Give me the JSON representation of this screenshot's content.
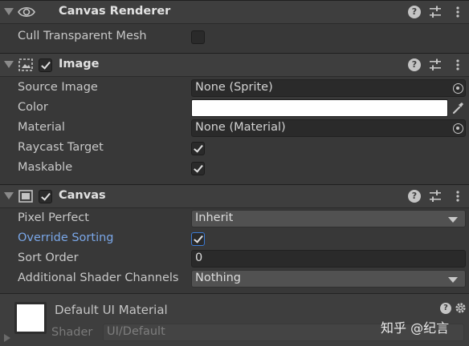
{
  "canvas_renderer": {
    "title": "Canvas Renderer",
    "properties": [
      {
        "label": "Cull Transparent Mesh",
        "checked": false
      }
    ]
  },
  "image": {
    "title": "Image",
    "enabled": true,
    "source_image": {
      "label": "Source Image",
      "value": "None (Sprite)"
    },
    "color": {
      "label": "Color",
      "value": "#ffffff"
    },
    "material": {
      "label": "Material",
      "value": "None (Material)"
    },
    "raycast_target": {
      "label": "Raycast Target",
      "checked": true
    },
    "maskable": {
      "label": "Maskable",
      "checked": true
    }
  },
  "canvas": {
    "title": "Canvas",
    "enabled": true,
    "pixel_perfect": {
      "label": "Pixel Perfect",
      "value": "Inherit"
    },
    "override_sorting": {
      "label": "Override Sorting",
      "checked": true
    },
    "sort_order": {
      "label": "Sort Order",
      "value": "0"
    },
    "additional_shader_channels": {
      "label": "Additional Shader Channels",
      "value": "Nothing"
    }
  },
  "material_preview": {
    "name": "Default UI Material",
    "shader_label": "Shader",
    "shader_value": "UI/Default"
  },
  "header_icons": {
    "help": "?"
  },
  "watermark": "知乎 @纪言"
}
